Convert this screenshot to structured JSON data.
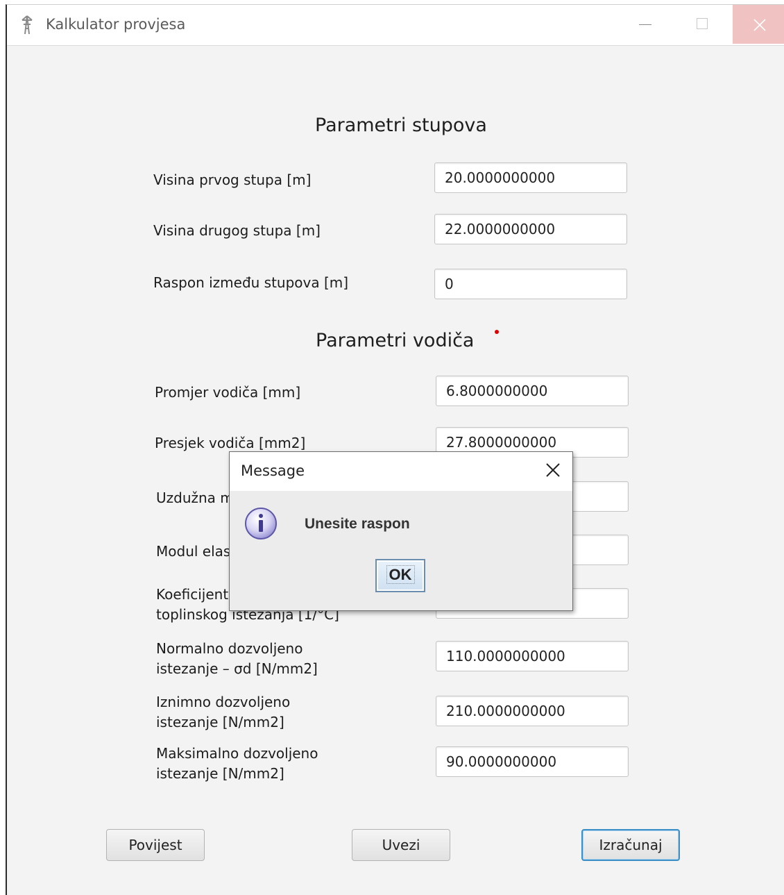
{
  "window": {
    "title": "Kalkulator provjesa"
  },
  "sections": {
    "stupovi": "Parametri stupova",
    "vodic": "Parametri vodiča"
  },
  "fields": [
    {
      "label": "Visina prvog stupa [m]",
      "value": "20.0000000000"
    },
    {
      "label": "Visina drugog stupa [m]",
      "value": "22.0000000000"
    },
    {
      "label": "Raspon između stupova [m]",
      "value": "0"
    },
    {
      "label": "Promjer vodiča [mm]",
      "value": "6.8000000000"
    },
    {
      "label": "Presjek vodiča [mm2]",
      "value": "27.8000000000"
    },
    {
      "label": "Uzdužna m",
      "value": ""
    },
    {
      "label": "Modul elas",
      "value": ""
    },
    {
      "label_line1": "Koeficijent",
      "label_line2": "toplinskog istezanja [1/°C]",
      "value": ""
    },
    {
      "label_line1": "Normalno dozvoljeno",
      "label_line2": "istezanje – σd [N/mm2]",
      "value": "110.0000000000"
    },
    {
      "label_line1": "Iznimno dozvoljeno",
      "label_line2": "istezanje [N/mm2]",
      "value": "210.0000000000"
    },
    {
      "label_line1": "Maksimalno dozvoljeno",
      "label_line2": "istezanje [N/mm2]",
      "value": "90.0000000000"
    }
  ],
  "buttons": {
    "history": "Povijest",
    "import": "Uvezi",
    "calculate": "Izračunaj"
  },
  "dialog": {
    "title": "Message",
    "message": "Unesite raspon",
    "ok": "OK"
  },
  "colors": {
    "accent": "#3c8fc7",
    "close_hover": "#f0c2c2",
    "validation_dot": "#e00000"
  }
}
